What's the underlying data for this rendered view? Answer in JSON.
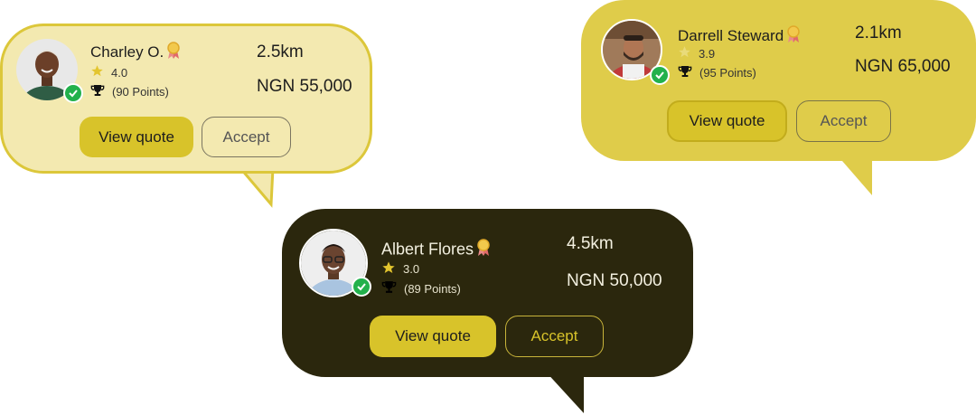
{
  "colors": {
    "accent_yellow": "#d8c32a",
    "card_light": "#f3e9b0",
    "card_mid": "#dfcc4a",
    "card_dark": "#2b270d",
    "verified_green": "#22b14c",
    "star": "#e3c52e"
  },
  "quotes": [
    {
      "name": "Charley O.",
      "rating": "4.0",
      "points": "(90 Points)",
      "distance": "2.5km",
      "price": "NGN 55,000",
      "view_label": "View quote",
      "accept_label": "Accept"
    },
    {
      "name": "Darrell Steward",
      "rating": "3.9",
      "points": "(95 Points)",
      "distance": "2.1km",
      "price": "NGN 65,000",
      "view_label": "View quote",
      "accept_label": "Accept"
    },
    {
      "name": "Albert Flores",
      "rating": "3.0",
      "points": "(89 Points)",
      "distance": "4.5km",
      "price": "NGN 50,000",
      "view_label": "View quote",
      "accept_label": "Accept"
    }
  ],
  "icons": {
    "rating": "star-icon",
    "points": "trophy-icon",
    "badge": "medal-icon",
    "verified": "checkmark-icon"
  }
}
